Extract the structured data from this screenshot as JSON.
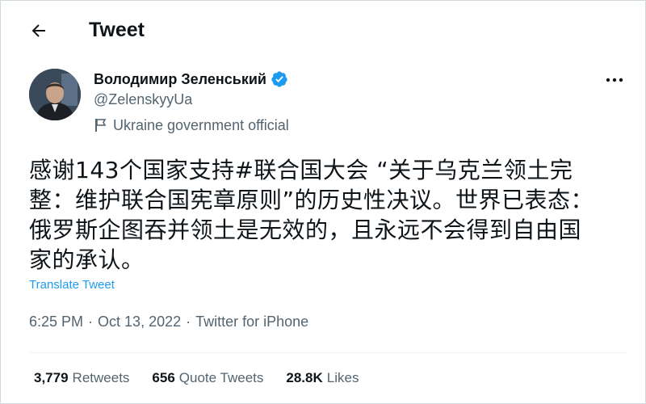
{
  "header": {
    "title": "Tweet"
  },
  "author": {
    "name": "Володимир Зеленський",
    "handle": "@ZelenskyyUa",
    "affiliation": "Ukraine government official",
    "verified": true
  },
  "tweet": {
    "text": "感谢143个国家支持#联合国大会 “关于乌克兰领土完\n整：维护联合国宪章原则”的历史性决议。世界已表态：\n俄罗斯企图吞并领土是无效的，且永远不会得到自由国\n家的承认。",
    "translate_label": "Translate Tweet",
    "time": "6:25 PM",
    "date": "Oct 13, 2022",
    "source": "Twitter for iPhone",
    "separator": "·"
  },
  "stats": [
    {
      "count": "3,779",
      "label": "Retweets"
    },
    {
      "count": "656",
      "label": "Quote Tweets"
    },
    {
      "count": "28.8K",
      "label": "Likes"
    }
  ],
  "colors": {
    "accent": "#1d9bf0",
    "text": "#0f1419",
    "secondary": "#536471"
  },
  "icons": {
    "back": "arrow-left-icon",
    "verified": "verified-badge-icon",
    "flag": "flag-icon",
    "more": "more-horizontal-icon"
  }
}
